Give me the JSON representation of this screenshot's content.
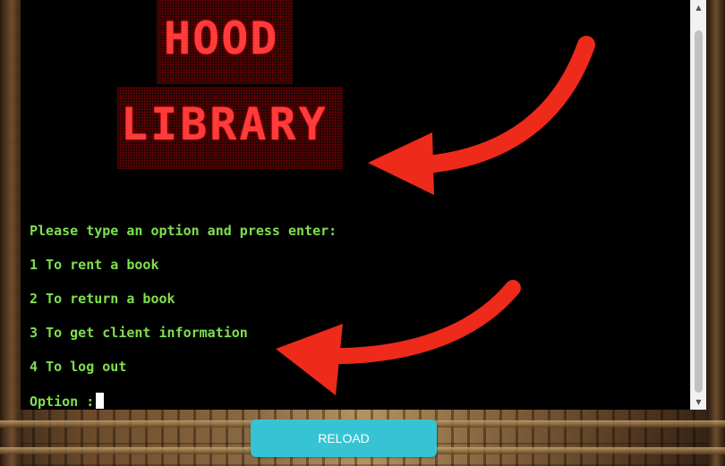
{
  "banner": {
    "line1": "HOOD",
    "line2": "LIBRARY"
  },
  "terminal": {
    "prompt": "Please type an option and press enter:",
    "options": [
      "1 To rent a book",
      "2 To return a book",
      "3 To get client information",
      "4 To log out"
    ],
    "input_label": "Option :"
  },
  "scrollbar": {
    "up_icon": "▲",
    "down_icon": "▼"
  },
  "reload": {
    "label": "RELOAD"
  },
  "colors": {
    "terminal_text": "#7fe04e",
    "banner_text": "#ff3b3b",
    "arrow": "#ee2a1b",
    "reload_bg": "#36c4d4"
  }
}
